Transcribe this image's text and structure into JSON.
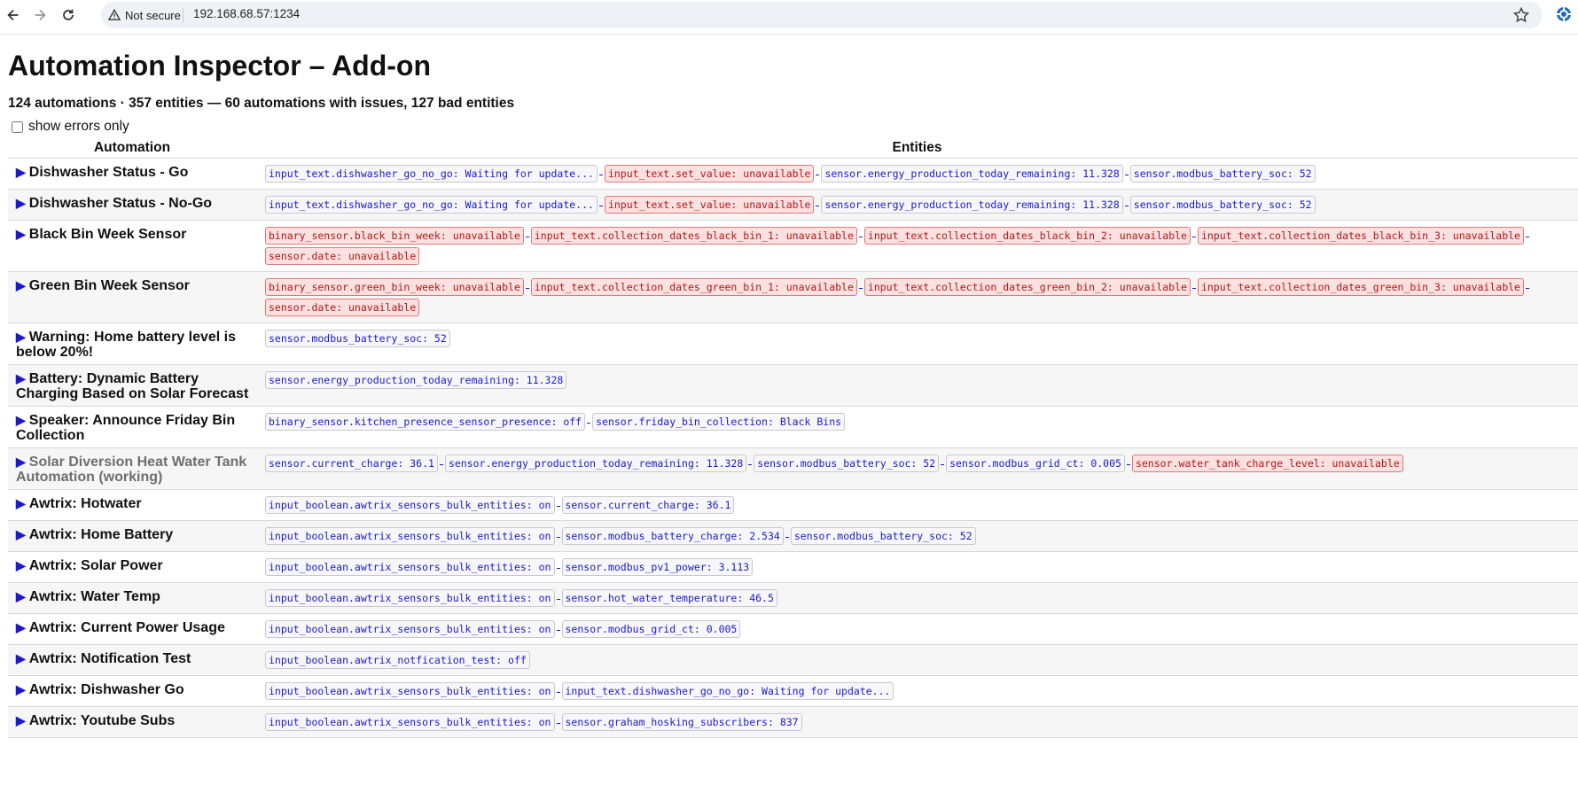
{
  "browser": {
    "security_label": "Not secure",
    "url": "192.168.68.57:1234"
  },
  "page": {
    "title": "Automation Inspector – Add-on",
    "summary": "124 automations · 357 entities — 60 automations with issues, 127 bad entities",
    "filter_label": "show errors only",
    "filter_checked": false,
    "columns": {
      "automation": "Automation",
      "entities": "Entities"
    }
  },
  "colors": {
    "link": "#1a1acc",
    "bad_bg": "#fde0e0",
    "bad_border": "#e07a7a",
    "bad_text": "#b01818",
    "disabled_text": "#6e6e6e"
  },
  "rows": [
    {
      "name": "Dishwasher Status - Go",
      "disabled": false,
      "entities": [
        {
          "text": "input_text.dishwasher_go_no_go: Waiting for update...",
          "bad": false
        },
        {
          "text": "input_text.set_value: unavailable",
          "bad": true
        },
        {
          "text": "sensor.energy_production_today_remaining: 11.328",
          "bad": false
        },
        {
          "text": "sensor.modbus_battery_soc: 52",
          "bad": false
        }
      ]
    },
    {
      "name": "Dishwasher Status - No-Go",
      "disabled": false,
      "entities": [
        {
          "text": "input_text.dishwasher_go_no_go: Waiting for update...",
          "bad": false
        },
        {
          "text": "input_text.set_value: unavailable",
          "bad": true
        },
        {
          "text": "sensor.energy_production_today_remaining: 11.328",
          "bad": false
        },
        {
          "text": "sensor.modbus_battery_soc: 52",
          "bad": false
        }
      ]
    },
    {
      "name": "Black Bin Week Sensor",
      "disabled": false,
      "entities": [
        {
          "text": "binary_sensor.black_bin_week: unavailable",
          "bad": true
        },
        {
          "text": "input_text.collection_dates_black_bin_1: unavailable",
          "bad": true
        },
        {
          "text": "input_text.collection_dates_black_bin_2: unavailable",
          "bad": true
        },
        {
          "text": "input_text.collection_dates_black_bin_3: unavailable",
          "bad": true
        },
        {
          "text": "sensor.date: unavailable",
          "bad": true
        }
      ]
    },
    {
      "name": "Green Bin Week Sensor",
      "disabled": false,
      "entities": [
        {
          "text": "binary_sensor.green_bin_week: unavailable",
          "bad": true
        },
        {
          "text": "input_text.collection_dates_green_bin_1: unavailable",
          "bad": true
        },
        {
          "text": "input_text.collection_dates_green_bin_2: unavailable",
          "bad": true
        },
        {
          "text": "input_text.collection_dates_green_bin_3: unavailable",
          "bad": true
        },
        {
          "text": "sensor.date: unavailable",
          "bad": true
        }
      ]
    },
    {
      "name": "Warning: Home battery level is below 20%!",
      "disabled": false,
      "entities": [
        {
          "text": "sensor.modbus_battery_soc: 52",
          "bad": false
        }
      ]
    },
    {
      "name": "Battery: Dynamic Battery Charging Based on Solar Forecast",
      "disabled": false,
      "entities": [
        {
          "text": "sensor.energy_production_today_remaining: 11.328",
          "bad": false
        }
      ]
    },
    {
      "name": "Speaker: Announce Friday Bin Collection",
      "disabled": false,
      "entities": [
        {
          "text": "binary_sensor.kitchen_presence_sensor_presence: off",
          "bad": false
        },
        {
          "text": "sensor.friday_bin_collection: Black Bins",
          "bad": false
        }
      ]
    },
    {
      "name": "Solar Diversion Heat Water Tank Automation (working)",
      "disabled": true,
      "entities": [
        {
          "text": "sensor.current_charge: 36.1",
          "bad": false
        },
        {
          "text": "sensor.energy_production_today_remaining: 11.328",
          "bad": false
        },
        {
          "text": "sensor.modbus_battery_soc: 52",
          "bad": false
        },
        {
          "text": "sensor.modbus_grid_ct: 0.005",
          "bad": false
        },
        {
          "text": "sensor.water_tank_charge_level: unavailable",
          "bad": true
        }
      ]
    },
    {
      "name": "Awtrix: Hotwater",
      "disabled": false,
      "entities": [
        {
          "text": "input_boolean.awtrix_sensors_bulk_entities: on",
          "bad": false
        },
        {
          "text": "sensor.current_charge: 36.1",
          "bad": false
        }
      ]
    },
    {
      "name": "Awtrix: Home Battery",
      "disabled": false,
      "entities": [
        {
          "text": "input_boolean.awtrix_sensors_bulk_entities: on",
          "bad": false
        },
        {
          "text": "sensor.modbus_battery_charge: 2.534",
          "bad": false
        },
        {
          "text": "sensor.modbus_battery_soc: 52",
          "bad": false
        }
      ]
    },
    {
      "name": "Awtrix: Solar Power",
      "disabled": false,
      "entities": [
        {
          "text": "input_boolean.awtrix_sensors_bulk_entities: on",
          "bad": false
        },
        {
          "text": "sensor.modbus_pv1_power: 3.113",
          "bad": false
        }
      ]
    },
    {
      "name": "Awtrix: Water Temp",
      "disabled": false,
      "entities": [
        {
          "text": "input_boolean.awtrix_sensors_bulk_entities: on",
          "bad": false
        },
        {
          "text": "sensor.hot_water_temperature: 46.5",
          "bad": false
        }
      ]
    },
    {
      "name": "Awtrix: Current Power Usage",
      "disabled": false,
      "entities": [
        {
          "text": "input_boolean.awtrix_sensors_bulk_entities: on",
          "bad": false
        },
        {
          "text": "sensor.modbus_grid_ct: 0.005",
          "bad": false
        }
      ]
    },
    {
      "name": "Awtrix: Notification Test",
      "disabled": false,
      "entities": [
        {
          "text": "input_boolean.awtrix_notfication_test: off",
          "bad": false
        }
      ]
    },
    {
      "name": "Awtrix: Dishwasher Go",
      "disabled": false,
      "entities": [
        {
          "text": "input_boolean.awtrix_sensors_bulk_entities: on",
          "bad": false
        },
        {
          "text": "input_text.dishwasher_go_no_go: Waiting for update...",
          "bad": false
        }
      ]
    },
    {
      "name": "Awtrix: Youtube Subs",
      "disabled": false,
      "entities": [
        {
          "text": "input_boolean.awtrix_sensors_bulk_entities: on",
          "bad": false
        },
        {
          "text": "sensor.graham_hosking_subscribers: 837",
          "bad": false
        }
      ]
    }
  ]
}
